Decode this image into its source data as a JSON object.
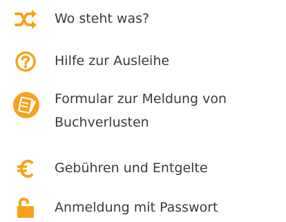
{
  "colors": {
    "accent": "#f7a21b",
    "text": "#3a3a3a",
    "background": "#ffffff"
  },
  "menu": {
    "items": [
      {
        "icon": "shuffle-icon",
        "label": "Wo steht was?"
      },
      {
        "icon": "question-circle-icon",
        "label": "Hilfe zur Ausleihe"
      },
      {
        "icon": "form-edit-icon",
        "label_line1": "Formular zur Meldung von",
        "label_line2": "Buchverlusten"
      },
      {
        "icon": "euro-icon",
        "label": "Gebühren und Entgelte"
      },
      {
        "icon": "lock-open-icon",
        "label": "Anmeldung mit Passwort"
      }
    ]
  }
}
